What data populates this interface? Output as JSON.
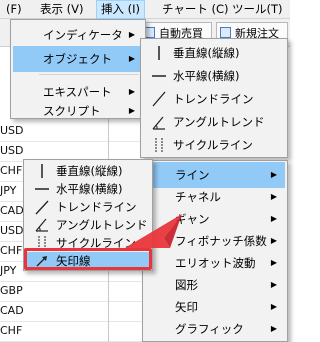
{
  "menubar": {
    "items": [
      {
        "label": "(F)"
      },
      {
        "label": "表示 (V)"
      },
      {
        "label": "挿入 (I)"
      },
      {
        "label": "チャート (C)"
      },
      {
        "label": "ツール(T)"
      }
    ]
  },
  "toolbar": {
    "auto_trade_label": "自動売買",
    "new_order_label": "新規注文"
  },
  "symbols": [
    "USD",
    "USD",
    "CHF",
    "JPY",
    "CAD",
    "USD",
    "CHF",
    "JPY",
    "GBP",
    "CAD",
    "CHF"
  ],
  "insert_menu": {
    "items": [
      {
        "label": "インディケータ",
        "has_submenu": true
      },
      {
        "label": "オブジェクト",
        "has_submenu": true
      },
      {
        "label": "エキスパート",
        "has_submenu": true
      },
      {
        "label": "スクリプト",
        "has_submenu": true
      }
    ]
  },
  "objects_menu": {
    "items": [
      {
        "label": "垂直線(縦線)",
        "icon": "vertical-line-icon"
      },
      {
        "label": "水平線(横線)",
        "icon": "horizontal-line-icon"
      },
      {
        "label": "トレンドライン",
        "icon": "trendline-icon"
      },
      {
        "label": "アングルトレンド",
        "icon": "angle-trend-icon"
      },
      {
        "label": "サイクルライン",
        "icon": "cycle-lines-icon"
      }
    ]
  },
  "category_menu": {
    "items": [
      {
        "label": "ライン"
      },
      {
        "label": "チャネル"
      },
      {
        "label": "ギャン"
      },
      {
        "label": "フィボナッチ係数"
      },
      {
        "label": "エリオット波動"
      },
      {
        "label": "図形"
      },
      {
        "label": "矢印"
      },
      {
        "label": "グラフィック"
      }
    ]
  },
  "lines_menu": {
    "items": [
      {
        "label": "垂直線(縦線)",
        "icon": "vertical-line-icon"
      },
      {
        "label": "水平線(横線)",
        "icon": "horizontal-line-icon"
      },
      {
        "label": "トレンドライン",
        "icon": "trendline-icon"
      },
      {
        "label": "アングルトレンド",
        "icon": "angle-trend-icon"
      },
      {
        "label": "サイクルライン",
        "icon": "cycle-lines-icon"
      },
      {
        "label": "矢印線",
        "icon": "arrow-line-icon"
      }
    ]
  },
  "colors": {
    "highlight": "#91c9f7",
    "annotation": "#e8353b"
  }
}
